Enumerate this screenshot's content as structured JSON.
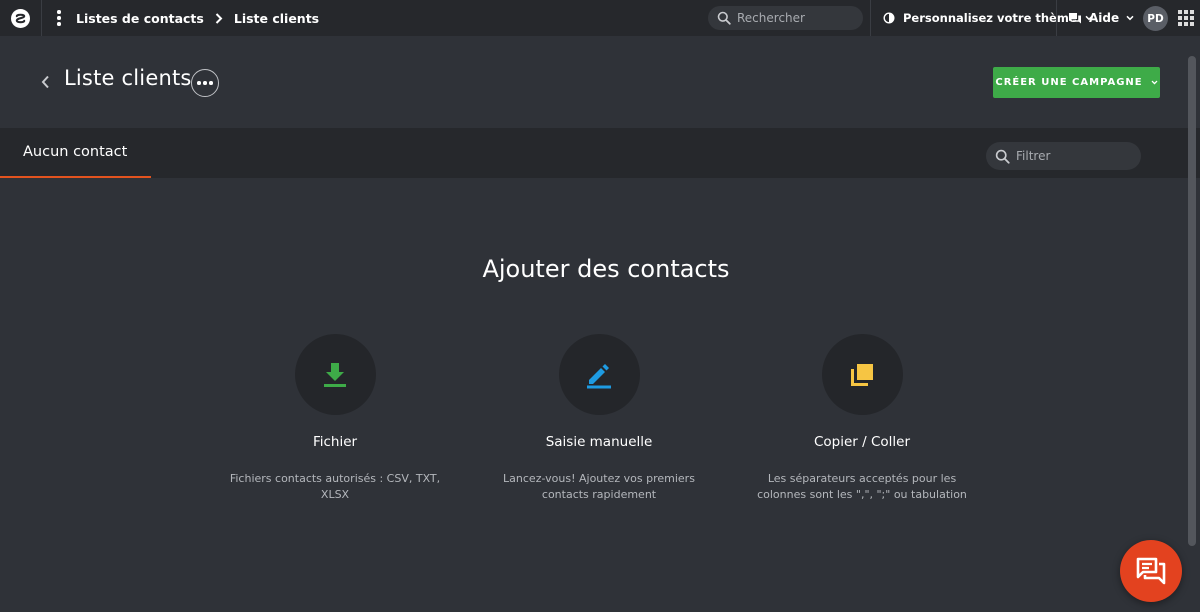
{
  "topbar": {
    "breadcrumbs": [
      "Listes de contacts",
      "Liste clients"
    ],
    "search_placeholder": "Rechercher",
    "theme_label": "Personnalisez votre thème",
    "help_label": "Aide",
    "avatar_initials": "PD"
  },
  "header": {
    "title": "Liste clients",
    "campaign_button": "CRÉER UNE CAMPAGNE"
  },
  "tabs": {
    "active_label": "Aucun contact",
    "filter_placeholder": "Filtrer"
  },
  "main": {
    "title": "Ajouter des contacts",
    "options": [
      {
        "label": "Fichier",
        "description": "Fichiers contacts autorisés : CSV, TXT, XLSX",
        "icon": "download-icon",
        "color": "#3eab48"
      },
      {
        "label": "Saisie manuelle",
        "description": "Lancez-vous! Ajoutez vos premiers contacts rapidement",
        "icon": "pencil-icon",
        "color": "#1e9be2"
      },
      {
        "label": "Copier / Coller",
        "description": "Les séparateurs acceptés pour les colonnes sont les \",\", \";\" ou tabulation",
        "icon": "copy-icon",
        "color": "#f6c543"
      }
    ]
  },
  "colors": {
    "accent": "#e3531f",
    "primary_button": "#3eab48",
    "chat_button": "#e3421f",
    "background": "#2f3238",
    "topbar": "#26282c"
  }
}
